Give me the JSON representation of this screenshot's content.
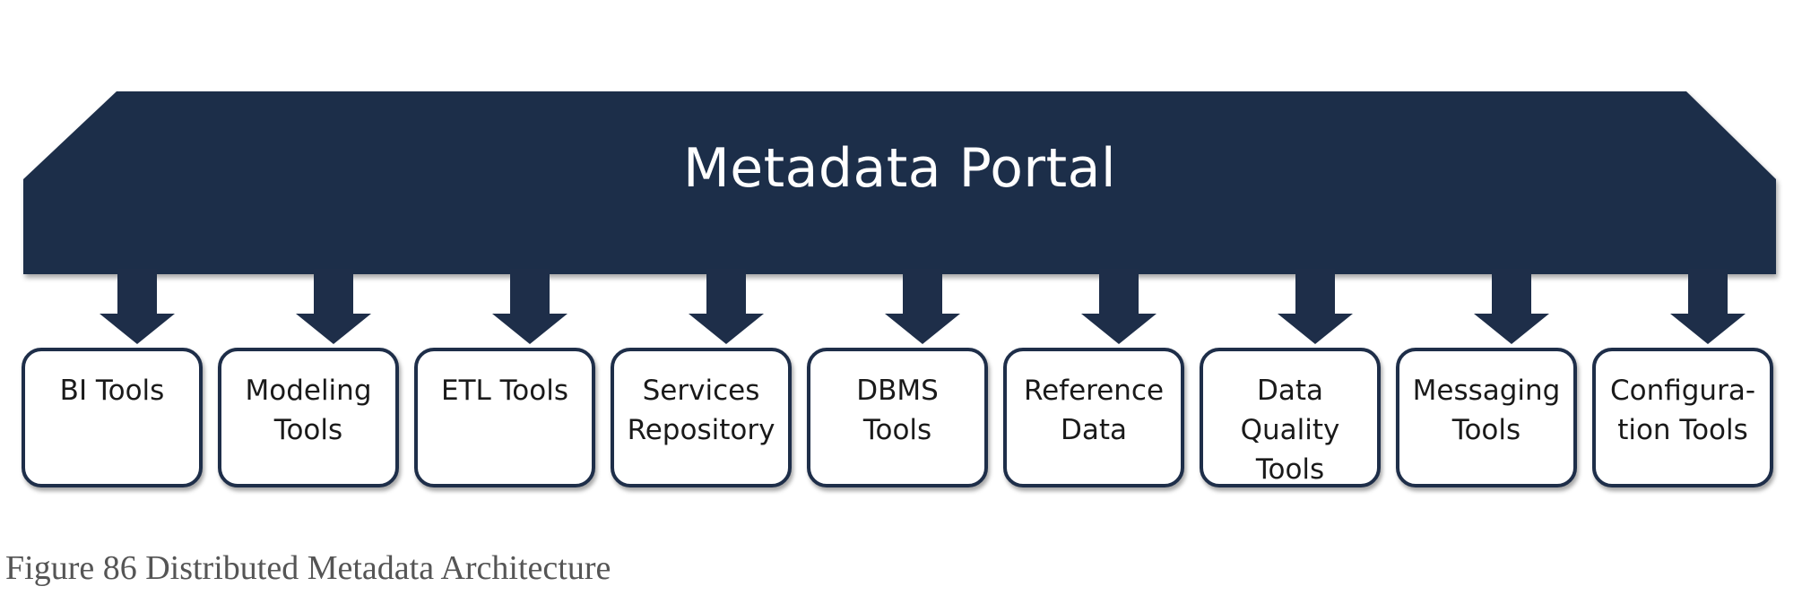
{
  "portal": {
    "title": "Metadata Portal",
    "color": "#1e2e49"
  },
  "tools": [
    {
      "label": "BI Tools"
    },
    {
      "label": "Modeling\nTools"
    },
    {
      "label": "ETL Tools"
    },
    {
      "label": "Services\nRepository"
    },
    {
      "label": "DBMS\nTools"
    },
    {
      "label": "Reference\nData"
    },
    {
      "label": "Data\nQuality\nTools"
    },
    {
      "label": "Messaging\nTools"
    },
    {
      "label": "Configura-\ntion Tools"
    }
  ],
  "caption": {
    "text": "Figure 86 Distributed Metadata Architecture"
  }
}
